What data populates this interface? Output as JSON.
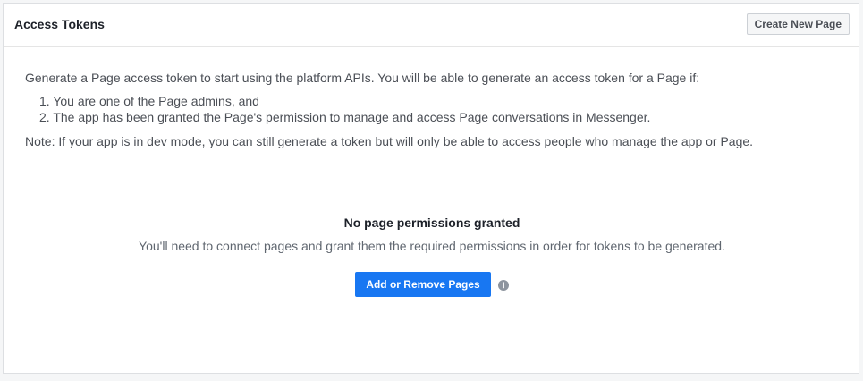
{
  "header": {
    "title": "Access Tokens",
    "create_button_label": "Create New Page"
  },
  "intro": {
    "text": "Generate a Page access token to start using the platform APIs. You will be able to generate an access token for a Page if:",
    "steps": [
      "1. You are one of the Page admins, and",
      "2. The app has been granted the Page's permission to manage and access Page conversations in Messenger."
    ],
    "note": "Note: If your app is in dev mode, you can still generate a token but will only be able to access people who manage the app or Page."
  },
  "empty_state": {
    "title": "No page permissions granted",
    "description": "You'll need to connect pages and grant them the required permissions in order for tokens to be generated.",
    "button_label": "Add or Remove Pages",
    "info_icon": "info-circle-icon"
  },
  "colors": {
    "primary": "#1877f2",
    "border": "#dddfe2",
    "text": "#4b4f56"
  }
}
